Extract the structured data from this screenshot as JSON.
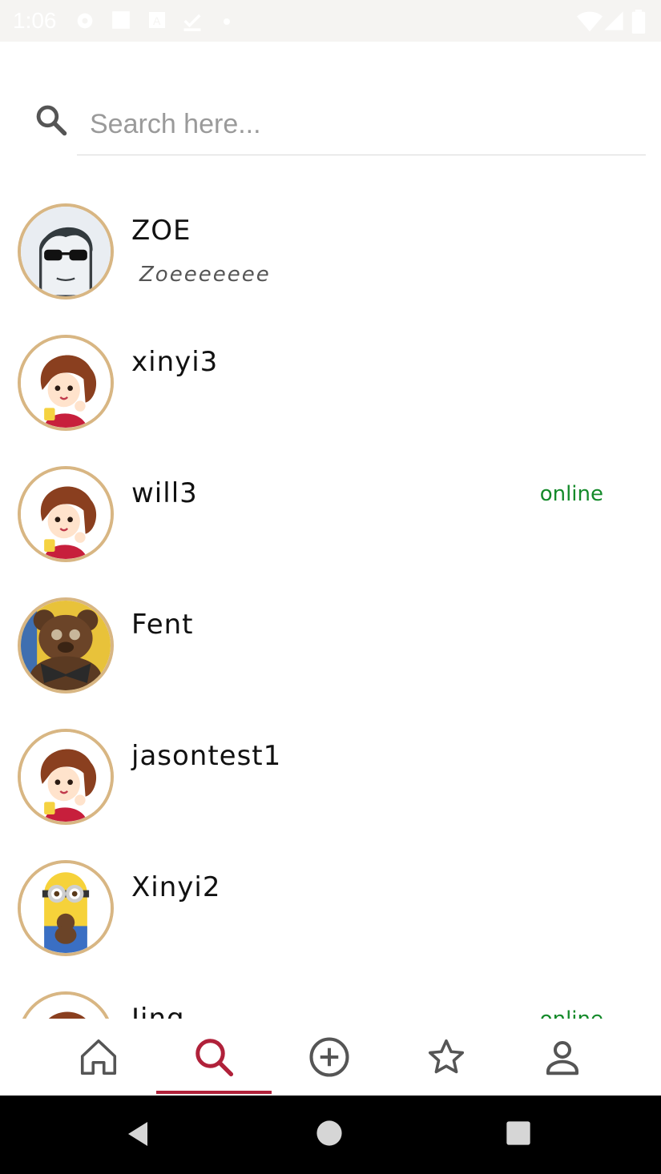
{
  "status_bar": {
    "time": "1:06"
  },
  "search": {
    "placeholder": "Search here...",
    "value": ""
  },
  "users": [
    {
      "name": "ZOE",
      "subtitle": "Zoeeeeeee",
      "status": "",
      "avatar": "sunglasses-man-avatar"
    },
    {
      "name": "xinyi3",
      "subtitle": "",
      "status": "",
      "avatar": "girl-coffee-avatar"
    },
    {
      "name": "will3",
      "subtitle": "",
      "status": "online",
      "avatar": "girl-coffee-avatar"
    },
    {
      "name": "Fent",
      "subtitle": "",
      "status": "",
      "avatar": "teddy-bear-avatar"
    },
    {
      "name": "jasontest1",
      "subtitle": "",
      "status": "",
      "avatar": "girl-coffee-avatar"
    },
    {
      "name": "Xinyi2",
      "subtitle": "",
      "status": "",
      "avatar": "minion-avatar"
    },
    {
      "name": "Jing",
      "subtitle": "",
      "status": "online",
      "avatar": "girl-coffee-avatar"
    }
  ],
  "bottom_nav": {
    "items": [
      "home-icon",
      "search-icon",
      "add-circle-icon",
      "star-icon",
      "person-icon"
    ],
    "active": "search-icon",
    "accent_color": "#b0213a"
  },
  "colors": {
    "avatar_border": "#d8b683",
    "online": "#148a2a"
  }
}
